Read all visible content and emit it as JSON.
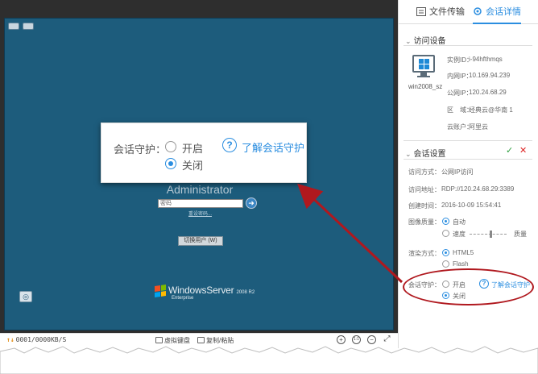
{
  "remote": {
    "username": "Administrator",
    "password_placeholder": "密码",
    "go_icon": "arrow-right-icon",
    "reset_link": "重设密码...",
    "switch_user": "切换用户 (W)",
    "windows_brand": "WindowsServer",
    "windows_version": "2008 R2",
    "windows_edition": "Enterprise",
    "ease_icon": "ease-of-access-icon"
  },
  "callout": {
    "label": "会话守护：",
    "option_on": "开启",
    "option_off": "关闭",
    "help_icon": "?",
    "help_link": "了解会话守护",
    "selected": "关闭"
  },
  "toolbar": {
    "rate_arrows": "↑↓",
    "rate": "0001/0000KB/S",
    "virtual_keyboard": "虚拟键盘",
    "copy_paste": "复制/粘贴",
    "zoom_in_icon": "zoom-in-icon",
    "zoom_in": "+",
    "zoom_actual_icon": "zoom-actual-icon",
    "zoom_actual": "1:1",
    "zoom_out_icon": "zoom-out-icon",
    "zoom_out": "−",
    "fullscreen_icon": "fullscreen-icon",
    "fullscreen": "⤢"
  },
  "tabs": [
    {
      "label": "文件传输",
      "icon": "file-transfer-icon",
      "active": false
    },
    {
      "label": "会话详情",
      "icon": "gear-icon",
      "active": true
    }
  ],
  "device_section": {
    "title": "访问设备",
    "device_name": "win2008_sz",
    "fields": [
      {
        "key": "实例ID：",
        "value": "i-94hfthmqs"
      },
      {
        "key": "内网IP：",
        "value": "10.169.94.239"
      },
      {
        "key": "公网IP：",
        "value": "120.24.68.29"
      },
      {
        "key": "区　域：",
        "value": "经典云@华南 1"
      },
      {
        "key": "云账户：",
        "value": "阿里云"
      }
    ]
  },
  "settings_section": {
    "title": "会话设置",
    "confirm_icon": "✓",
    "cancel_icon": "✕",
    "fields": [
      {
        "key": "访问方式：",
        "value": "公网IP访问"
      },
      {
        "key": "访问地址：",
        "value": "RDP://120.24.68.29:3389"
      },
      {
        "key": "创建时间：",
        "value": "2016-10-09 15:54:41"
      }
    ],
    "image_quality": {
      "label": "图像质量：",
      "options": [
        "自动",
        "速度",
        "质量"
      ],
      "selected": "自动"
    },
    "render_mode": {
      "label": "渲染方式：",
      "options": [
        "HTML5",
        "Flash"
      ],
      "selected": "HTML5"
    },
    "session_guard": {
      "label": "会话守护：",
      "options": [
        "开启",
        "关闭"
      ],
      "selected": "关闭",
      "help_link": "了解会话守护"
    }
  },
  "colors": {
    "accent": "#2b8ee0",
    "screen_bg": "#1d5c7c",
    "annotation_red": "#b0181e"
  }
}
